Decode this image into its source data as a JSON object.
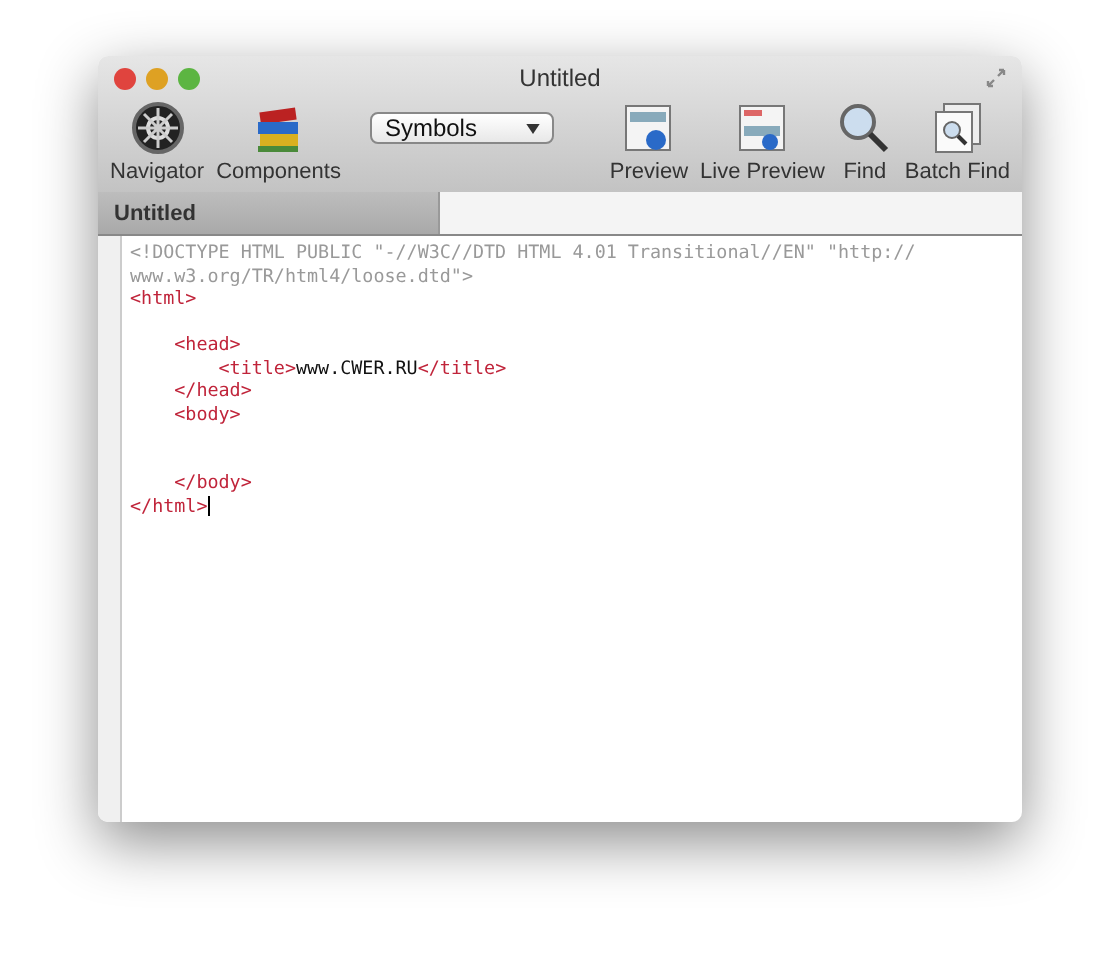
{
  "window": {
    "title": "Untitled"
  },
  "toolbar": {
    "left": [
      {
        "kind": "navigator",
        "label": "Navigator"
      },
      {
        "kind": "components",
        "label": "Components"
      }
    ],
    "dropdown": {
      "value": "Symbols"
    },
    "right": [
      {
        "kind": "preview",
        "label": "Preview"
      },
      {
        "kind": "live",
        "label": "Live Preview"
      },
      {
        "kind": "find",
        "label": "Find"
      },
      {
        "kind": "batch",
        "label": "Batch Find"
      }
    ]
  },
  "tabs": [
    {
      "label": "Untitled",
      "selected": true
    }
  ],
  "editor": {
    "lines": [
      {
        "kind": "code",
        "segments": [
          {
            "kind": "doctype",
            "text": "<!DOCTYPE HTML PUBLIC \"-//W3C//DTD HTML 4.01 Transitional//EN\" \"http://"
          }
        ]
      },
      {
        "kind": "code",
        "segments": [
          {
            "kind": "doctype",
            "text": "www.w3.org/TR/html4/loose.dtd\">"
          }
        ]
      },
      {
        "kind": "code",
        "segments": [
          {
            "kind": "tag",
            "text": "<html>"
          }
        ]
      },
      {
        "kind": "blank"
      },
      {
        "kind": "code",
        "segments": [
          {
            "kind": "tag",
            "text": "    <head>"
          }
        ]
      },
      {
        "kind": "code",
        "segments": [
          {
            "kind": "tag",
            "text": "        <title>"
          },
          {
            "kind": "text",
            "text": "www.CWER.RU"
          },
          {
            "kind": "tag",
            "text": "</title>"
          }
        ]
      },
      {
        "kind": "code",
        "segments": [
          {
            "kind": "tag",
            "text": "    </head>"
          }
        ]
      },
      {
        "kind": "code",
        "segments": [
          {
            "kind": "tag",
            "text": "    <body>"
          }
        ]
      },
      {
        "kind": "blank"
      },
      {
        "kind": "blank"
      },
      {
        "kind": "code",
        "segments": [
          {
            "kind": "tag",
            "text": "    </body>"
          }
        ]
      },
      {
        "kind": "code",
        "cursor": true,
        "segments": [
          {
            "kind": "tag",
            "text": "</html>"
          }
        ]
      }
    ]
  }
}
